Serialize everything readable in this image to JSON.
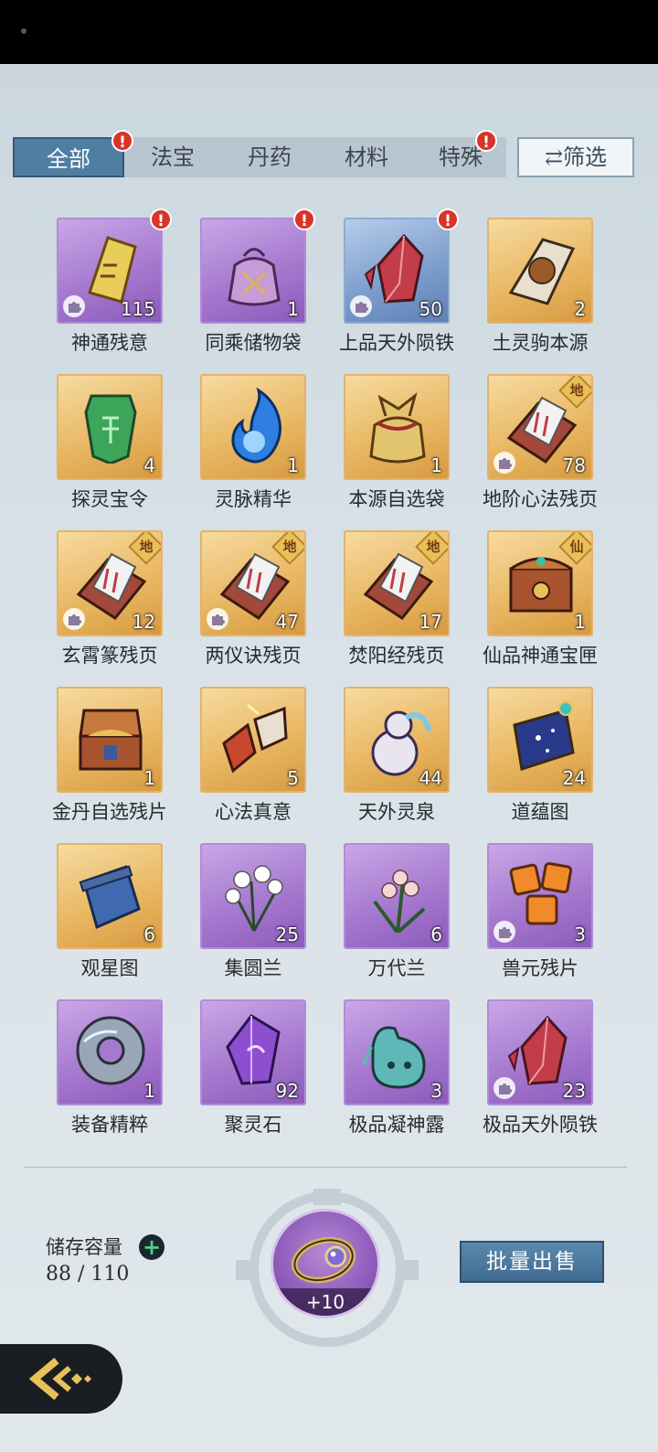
{
  "tabs": [
    {
      "label": "全部",
      "active": true,
      "badge": "!"
    },
    {
      "label": "法宝",
      "active": false,
      "badge": ""
    },
    {
      "label": "丹药",
      "active": false,
      "badge": ""
    },
    {
      "label": "材料",
      "active": false,
      "badge": ""
    },
    {
      "label": "特殊",
      "active": false,
      "badge": "!"
    }
  ],
  "filter": {
    "label": "⇄筛选",
    "icon": "swap-icon"
  },
  "items": [
    {
      "name": "神通残意",
      "count": "115",
      "rarity": "purple",
      "badge": "!",
      "fragment": true,
      "grade": "",
      "art": "scroll-fragment"
    },
    {
      "name": "同乘储物袋",
      "count": "1",
      "rarity": "purple",
      "badge": "!",
      "fragment": false,
      "grade": "",
      "art": "pouch"
    },
    {
      "name": "上品天外陨铁",
      "count": "50",
      "rarity": "blue",
      "badge": "!",
      "fragment": true,
      "grade": "",
      "art": "crystal-red"
    },
    {
      "name": "土灵驹本源",
      "count": "2",
      "rarity": "gold",
      "badge": "",
      "fragment": false,
      "grade": "",
      "art": "beast-card"
    },
    {
      "name": "探灵宝令",
      "count": "4",
      "rarity": "gold",
      "badge": "",
      "fragment": false,
      "grade": "",
      "art": "token-green"
    },
    {
      "name": "灵脉精华",
      "count": "1",
      "rarity": "gold",
      "badge": "",
      "fragment": false,
      "grade": "",
      "art": "blue-flame"
    },
    {
      "name": "本源自选袋",
      "count": "1",
      "rarity": "gold",
      "badge": "",
      "fragment": false,
      "grade": "",
      "art": "gold-pouch"
    },
    {
      "name": "地阶心法残页",
      "count": "78",
      "rarity": "gold",
      "badge": "",
      "fragment": true,
      "grade": "地",
      "art": "scroll-box"
    },
    {
      "name": "玄霄篆残页",
      "count": "12",
      "rarity": "gold",
      "badge": "",
      "fragment": true,
      "grade": "地",
      "art": "scroll-box"
    },
    {
      "name": "两仪诀残页",
      "count": "47",
      "rarity": "gold",
      "badge": "",
      "fragment": true,
      "grade": "地",
      "art": "scroll-box"
    },
    {
      "name": "焚阳经残页",
      "count": "17",
      "rarity": "gold",
      "badge": "",
      "fragment": false,
      "grade": "地",
      "art": "scroll-box"
    },
    {
      "name": "仙品神通宝匣",
      "count": "1",
      "rarity": "gold",
      "badge": "",
      "fragment": false,
      "grade": "仙",
      "art": "chest-ornate"
    },
    {
      "name": "金丹自选残片",
      "count": "1",
      "rarity": "gold",
      "badge": "",
      "fragment": false,
      "grade": "",
      "art": "chest-open"
    },
    {
      "name": "心法真意",
      "count": "5",
      "rarity": "gold",
      "badge": "",
      "fragment": false,
      "grade": "",
      "art": "broken-scroll"
    },
    {
      "name": "天外灵泉",
      "count": "44",
      "rarity": "gold",
      "badge": "",
      "fragment": false,
      "grade": "",
      "art": "gourd"
    },
    {
      "name": "道蕴图",
      "count": "24",
      "rarity": "gold",
      "badge": "",
      "fragment": false,
      "grade": "",
      "art": "star-map"
    },
    {
      "name": "观星图",
      "count": "6",
      "rarity": "gold",
      "badge": "",
      "fragment": false,
      "grade": "",
      "art": "scroll-blue"
    },
    {
      "name": "集圆兰",
      "count": "25",
      "rarity": "purple",
      "badge": "",
      "fragment": false,
      "grade": "",
      "art": "orchid-white"
    },
    {
      "name": "万代兰",
      "count": "6",
      "rarity": "purple",
      "badge": "",
      "fragment": false,
      "grade": "",
      "art": "orchid-pink"
    },
    {
      "name": "兽元残片",
      "count": "3",
      "rarity": "purple",
      "badge": "",
      "fragment": true,
      "grade": "",
      "art": "orange-shards"
    },
    {
      "name": "装备精粹",
      "count": "1",
      "rarity": "purple",
      "badge": "",
      "fragment": false,
      "grade": "",
      "art": "ring-disc"
    },
    {
      "name": "聚灵石",
      "count": "92",
      "rarity": "purple",
      "badge": "",
      "fragment": false,
      "grade": "",
      "art": "purple-gem"
    },
    {
      "name": "极品凝神露",
      "count": "3",
      "rarity": "purple",
      "badge": "",
      "fragment": false,
      "grade": "",
      "art": "teal-vase"
    },
    {
      "name": "极品天外陨铁",
      "count": "23",
      "rarity": "purple",
      "badge": "",
      "fragment": true,
      "grade": "",
      "art": "crystal-red"
    }
  ],
  "storage": {
    "label": "储存容量",
    "value": "88 / 110"
  },
  "ring": {
    "level": "+10"
  },
  "sell": {
    "label": "批量出售"
  },
  "colors": {
    "tab_active": "#4f7ea3",
    "badge": "#d8342a",
    "purple": "#a679cf",
    "gold": "#e9b864",
    "blue": "#7e9fcd"
  }
}
